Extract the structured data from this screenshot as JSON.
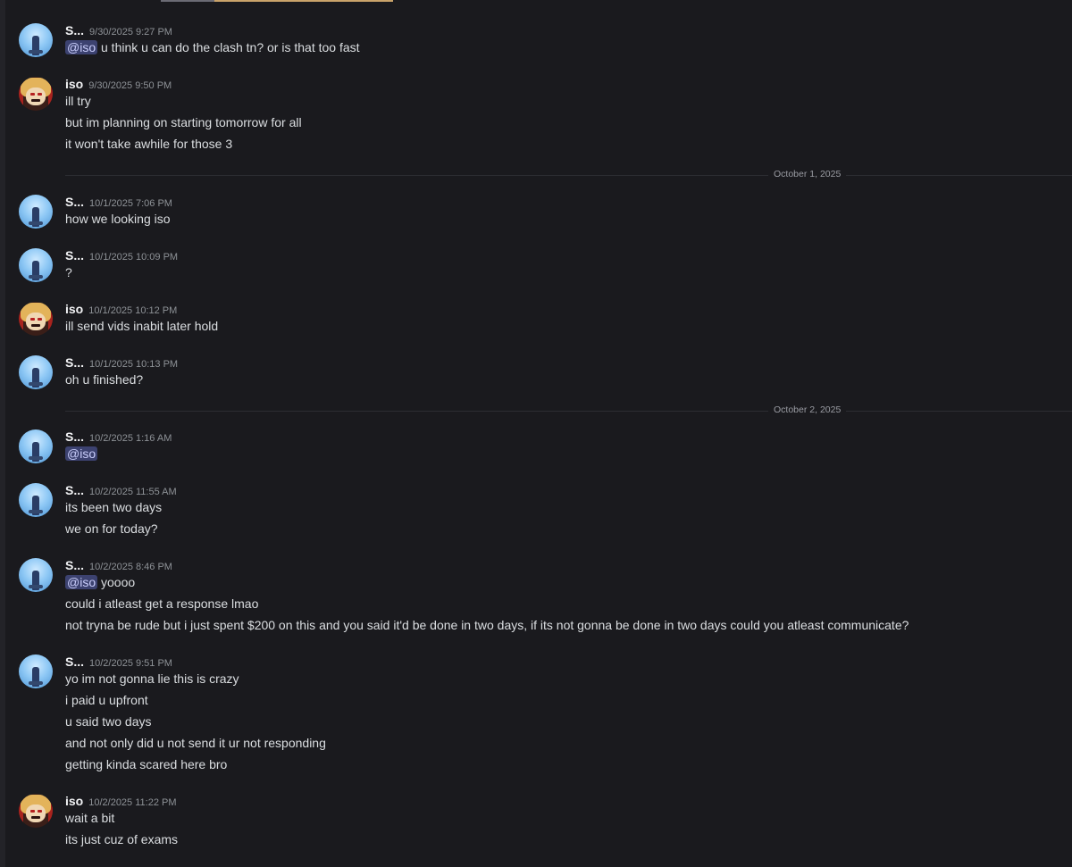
{
  "dividers": [
    "October 1, 2025",
    "October 2, 2025"
  ],
  "messages": [
    {
      "author": "S...",
      "time": "9/30/2025 9:27 PM",
      "mention": "@iso",
      "lines": [
        "u think u can do the clash tn? or is that too fast"
      ]
    },
    {
      "author": "iso",
      "time": "9/30/2025 9:50 PM",
      "lines": [
        "ill try",
        "but im planning on starting tomorrow for all",
        "it won't take awhile for those 3"
      ]
    },
    {
      "author": "S...",
      "time": "10/1/2025 7:06 PM",
      "lines": [
        "how we looking iso"
      ]
    },
    {
      "author": "S...",
      "time": "10/1/2025 10:09 PM",
      "lines": [
        "?"
      ]
    },
    {
      "author": "iso",
      "time": "10/1/2025 10:12 PM",
      "lines": [
        "ill send vids inabit later hold"
      ]
    },
    {
      "author": "S...",
      "time": "10/1/2025 10:13 PM",
      "lines": [
        "oh u finished?"
      ]
    },
    {
      "author": "S...",
      "time": "10/2/2025 1:16 AM",
      "mention": "@iso",
      "lines": [
        ""
      ]
    },
    {
      "author": "S...",
      "time": "10/2/2025 11:55 AM",
      "lines": [
        "its been two days",
        "we on for today?"
      ]
    },
    {
      "author": "S...",
      "time": "10/2/2025 8:46 PM",
      "mention": "@iso",
      "lines": [
        "yoooo",
        "could i atleast get a response lmao",
        "not tryna be rude but i just spent $200 on this and you said it'd be done in two days, if its not gonna be done in two days could you atleast communicate?"
      ]
    },
    {
      "author": "S...",
      "time": "10/2/2025 9:51 PM",
      "lines": [
        "yo im not gonna lie this is crazy",
        "i paid u upfront",
        "u said two days",
        "and not only did u not send it ur not responding",
        "getting kinda scared here bro"
      ]
    },
    {
      "author": "iso",
      "time": "10/2/2025 11:22 PM",
      "lines": [
        "wait a bit",
        "its just cuz of exams"
      ]
    }
  ]
}
